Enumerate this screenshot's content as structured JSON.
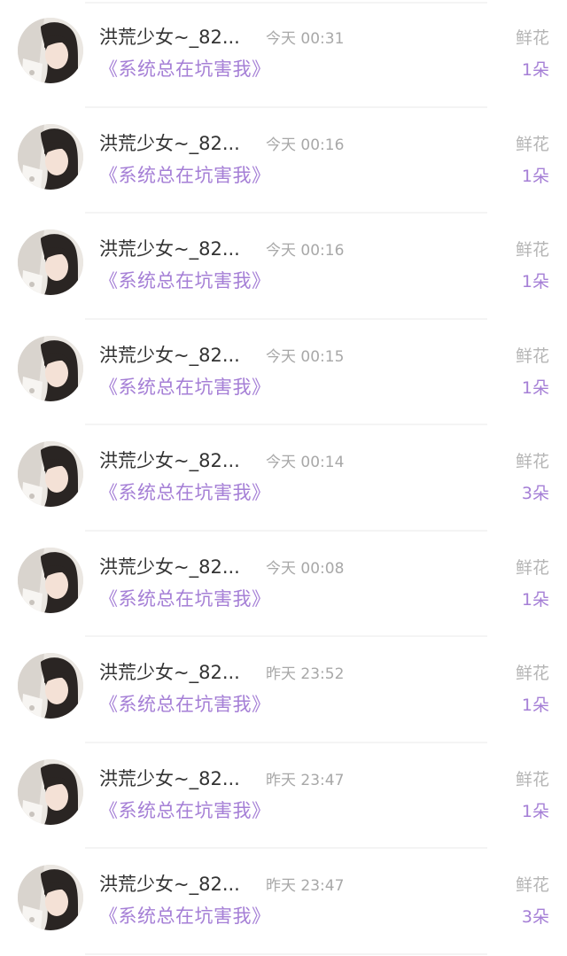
{
  "records": [
    {
      "name": "洪荒少女~_82...",
      "time": "今天 00:31",
      "book": "《系统总在坑害我》",
      "gift": "鲜花",
      "count": "1朵"
    },
    {
      "name": "洪荒少女~_82...",
      "time": "今天 00:16",
      "book": "《系统总在坑害我》",
      "gift": "鲜花",
      "count": "1朵"
    },
    {
      "name": "洪荒少女~_82...",
      "time": "今天 00:16",
      "book": "《系统总在坑害我》",
      "gift": "鲜花",
      "count": "1朵"
    },
    {
      "name": "洪荒少女~_82...",
      "time": "今天 00:15",
      "book": "《系统总在坑害我》",
      "gift": "鲜花",
      "count": "1朵"
    },
    {
      "name": "洪荒少女~_82...",
      "time": "今天 00:14",
      "book": "《系统总在坑害我》",
      "gift": "鲜花",
      "count": "3朵"
    },
    {
      "name": "洪荒少女~_82...",
      "time": "今天 00:08",
      "book": "《系统总在坑害我》",
      "gift": "鲜花",
      "count": "1朵"
    },
    {
      "name": "洪荒少女~_82...",
      "time": "昨天 23:52",
      "book": "《系统总在坑害我》",
      "gift": "鲜花",
      "count": "1朵"
    },
    {
      "name": "洪荒少女~_82...",
      "time": "昨天 23:47",
      "book": "《系统总在坑害我》",
      "gift": "鲜花",
      "count": "1朵"
    },
    {
      "name": "洪荒少女~_82...",
      "time": "昨天 23:47",
      "book": "《系统总在坑害我》",
      "gift": "鲜花",
      "count": "3朵"
    }
  ],
  "colors": {
    "accent": "#a57fd6",
    "name_text": "#333333",
    "muted_text": "#a8a8a8"
  },
  "icons": {
    "avatar": "user-avatar-photo"
  }
}
